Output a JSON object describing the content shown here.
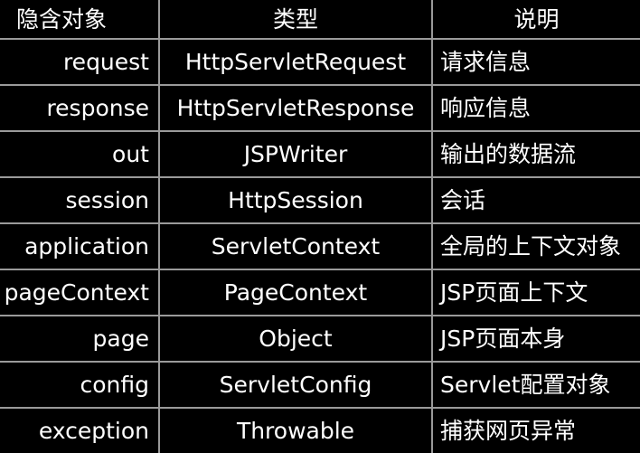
{
  "table": {
    "headers": {
      "object": "隐含对象",
      "type": "类型",
      "description": "说明"
    },
    "rows": [
      {
        "object": "request",
        "type": "HttpServletRequest",
        "description": "请求信息"
      },
      {
        "object": "response",
        "type": "HttpServletResponse",
        "description": "响应信息"
      },
      {
        "object": "out",
        "type": "JSPWriter",
        "description": "输出的数据流"
      },
      {
        "object": "session",
        "type": "HttpSession",
        "description": "会话"
      },
      {
        "object": "application",
        "type": "ServletContext",
        "description": "全局的上下文对象"
      },
      {
        "object": "pageContext",
        "type": "PageContext",
        "description": "JSP页面上下文"
      },
      {
        "object": "page",
        "type": "Object",
        "description": "JSP页面本身"
      },
      {
        "object": "config",
        "type": "ServletConfig",
        "description": "Servlet配置对象"
      },
      {
        "object": "exception",
        "type": "Throwable",
        "description": "捕获网页异常"
      }
    ]
  },
  "colors": {
    "background": "#000000",
    "text": "#ffffff",
    "grid": "#9a9a9a"
  }
}
